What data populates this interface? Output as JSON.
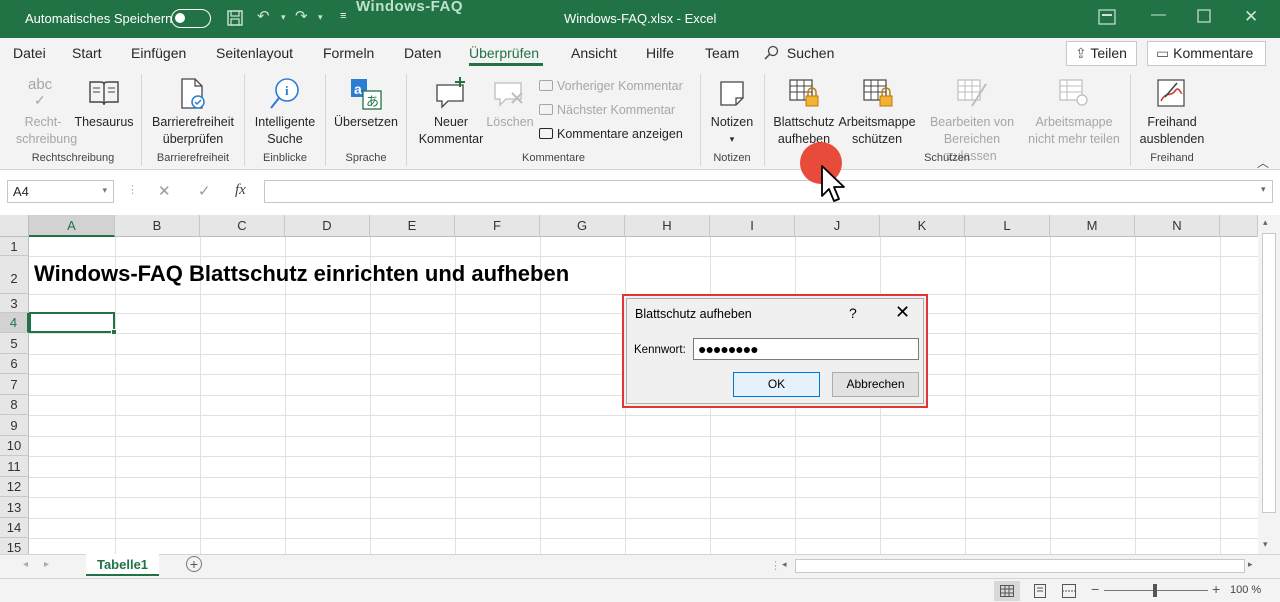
{
  "titlebar": {
    "autosave_label": "Automatisches Speichern",
    "watermark": "Windows-FAQ",
    "doc_title": "Windows-FAQ.xlsx  -  Excel"
  },
  "tabs": [
    "Datei",
    "Start",
    "Einfügen",
    "Seitenlayout",
    "Formeln",
    "Daten",
    "Überprüfen",
    "Ansicht",
    "Hilfe",
    "Team"
  ],
  "active_tab": "Überprüfen",
  "search": "Suchen",
  "share": "Teilen",
  "comments": "Kommentare",
  "ribbon": {
    "recht": [
      "Recht-",
      "schreibung"
    ],
    "thesaurus": "Thesaurus",
    "group_rechtschreibung": "Rechtschreibung",
    "barriere": [
      "Barrierefreiheit",
      "überprüfen"
    ],
    "group_barriere": "Barrierefreiheit",
    "intelligente": [
      "Intelligente",
      "Suche"
    ],
    "group_einblicke": "Einblicke",
    "uebersetzen": "Übersetzen",
    "group_sprache": "Sprache",
    "neuer_kommentar": [
      "Neuer",
      "Kommentar"
    ],
    "loeschen": "Löschen",
    "vorheriger": "Vorheriger Kommentar",
    "naechster": "Nächster Kommentar",
    "anzeigen": "Kommentare anzeigen",
    "group_kommentare": "Kommentare",
    "notizen": "Notizen",
    "group_notizen": "Notizen",
    "blattschutz": [
      "Blattschutz",
      "aufheben"
    ],
    "arbeitsmappe": [
      "Arbeitsmappe",
      "schützen"
    ],
    "bearbeiten": [
      "Bearbeiten von",
      "Bereichen zulassen"
    ],
    "nicht_mehr": [
      "Arbeitsmappe",
      "nicht mehr teilen"
    ],
    "group_schuetzen": "Schützen",
    "freihand": [
      "Freihand",
      "ausblenden"
    ],
    "group_freihand": "Freihand"
  },
  "namebox": "A4",
  "columns": [
    "A",
    "B",
    "C",
    "D",
    "E",
    "F",
    "G",
    "H",
    "I",
    "J",
    "K",
    "L",
    "M",
    "N"
  ],
  "rows": [
    "1",
    "2",
    "3",
    "4",
    "5",
    "6",
    "7",
    "8",
    "9",
    "10",
    "11",
    "12",
    "13",
    "14",
    "15"
  ],
  "cell_a2": "Windows-FAQ Blattschutz einrichten und aufheben",
  "sheet_tab": "Tabelle1",
  "zoom": "100 %",
  "dialog": {
    "title": "Blattschutz aufheben",
    "help": "?",
    "label": "Kennwort:",
    "password": "●●●●●●●●",
    "ok": "OK",
    "cancel": "Abbrechen"
  },
  "colors": {
    "excel_green": "#217346",
    "highlight": "#e03535"
  }
}
